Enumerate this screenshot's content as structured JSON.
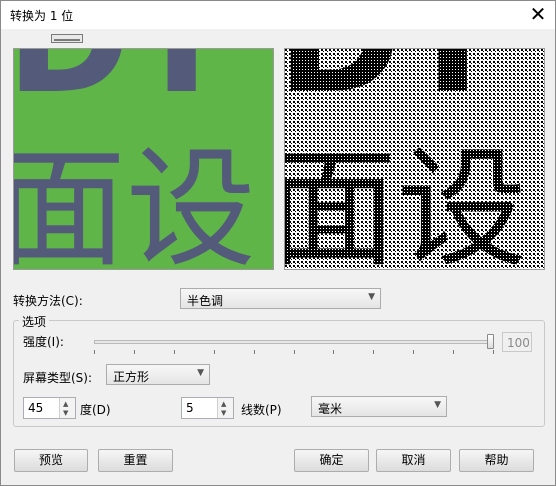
{
  "window": {
    "title": "转换为 1 位",
    "close_glyph": "✕"
  },
  "preview": {
    "chars_top": "DT",
    "chars_bottom": "面设",
    "colors": {
      "left_bg": "#5fb548",
      "left_text": "#545b7a",
      "right_bg": "#ffffff",
      "right_text": "#000000"
    }
  },
  "conversion": {
    "label": "转换方法(C):",
    "value": "半色调"
  },
  "options": {
    "group_title": "选项",
    "intensity_label": "强度(I):",
    "intensity_value": "100",
    "intensity_level": 1.0,
    "screen_type_label": "屏幕类型(S):",
    "screen_type_value": "正方形",
    "angle_value": "45",
    "angle_label": "度(D)",
    "lines_value": "5",
    "lines_label": "线数(P)",
    "unit_value": "毫米"
  },
  "buttons": {
    "preview": "预览",
    "reset": "重置",
    "ok": "确定",
    "cancel": "取消",
    "help": "帮助"
  }
}
